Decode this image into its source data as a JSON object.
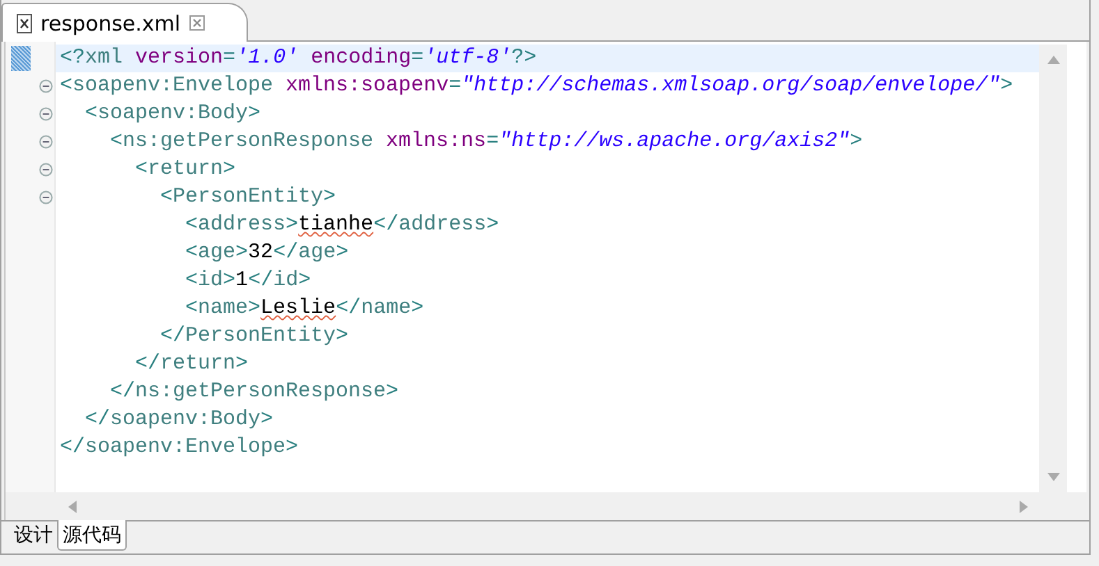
{
  "editor_tab": {
    "title": "response.xml",
    "selected": true
  },
  "lines": [
    {
      "current": true,
      "fold": false,
      "tokens": [
        {
          "kind": "bracket",
          "text": "<?"
        },
        {
          "kind": "tag",
          "text": "xml"
        },
        {
          "kind": "attr",
          "text": " version"
        },
        {
          "kind": "bracket",
          "text": "="
        },
        {
          "kind": "value",
          "text": "'1.0'"
        },
        {
          "kind": "attr",
          "text": " encoding"
        },
        {
          "kind": "bracket",
          "text": "="
        },
        {
          "kind": "value",
          "text": "'utf-8'"
        },
        {
          "kind": "bracket",
          "text": "?>"
        }
      ]
    },
    {
      "current": false,
      "fold": true,
      "tokens": [
        {
          "kind": "bracket",
          "text": "<"
        },
        {
          "kind": "tag",
          "text": "soapenv:Envelope"
        },
        {
          "kind": "attr",
          "text": " xmlns:soapenv"
        },
        {
          "kind": "bracket",
          "text": "="
        },
        {
          "kind": "value",
          "text": "\"http://schemas.xmlsoap.org/soap/envelope/\""
        },
        {
          "kind": "bracket",
          "text": ">"
        }
      ],
      "children": [
        {
          "current": false,
          "fold": true,
          "tokens": [
            {
              "kind": "bracket",
              "text": "<"
            },
            {
              "kind": "tag",
              "text": "soapenv:Body"
            },
            {
              "kind": "bracket",
              "text": ">"
            }
          ],
          "children": [
            {
              "current": false,
              "fold": true,
              "tokens": [
                {
                  "kind": "bracket",
                  "text": "<"
                },
                {
                  "kind": "tag",
                  "text": "ns:getPersonResponse"
                },
                {
                  "kind": "attr",
                  "text": " xmlns:ns"
                },
                {
                  "kind": "bracket",
                  "text": "="
                },
                {
                  "kind": "value",
                  "text": "\"http://ws.apache.org/axis2\""
                },
                {
                  "kind": "bracket",
                  "text": ">"
                }
              ],
              "children": [
                {
                  "current": false,
                  "fold": true,
                  "tokens": [
                    {
                      "kind": "bracket",
                      "text": "<"
                    },
                    {
                      "kind": "tag",
                      "text": "return"
                    },
                    {
                      "kind": "bracket",
                      "text": ">"
                    }
                  ],
                  "children": [
                    {
                      "current": false,
                      "fold": true,
                      "tokens": [
                        {
                          "kind": "bracket",
                          "text": "<"
                        },
                        {
                          "kind": "tag",
                          "text": "PersonEntity"
                        },
                        {
                          "kind": "bracket",
                          "text": ">"
                        }
                      ],
                      "children": [
                        {
                          "current": false,
                          "fold": false,
                          "tokens": [
                            {
                              "kind": "bracket",
                              "text": "<"
                            },
                            {
                              "kind": "tag",
                              "text": "address"
                            },
                            {
                              "kind": "bracket",
                              "text": ">"
                            },
                            {
                              "kind": "text",
                              "text": "tianhe",
                              "misspelled": true
                            },
                            {
                              "kind": "bracket",
                              "text": "</"
                            },
                            {
                              "kind": "tag",
                              "text": "address"
                            },
                            {
                              "kind": "bracket",
                              "text": ">"
                            }
                          ]
                        },
                        {
                          "current": false,
                          "fold": false,
                          "tokens": [
                            {
                              "kind": "bracket",
                              "text": "<"
                            },
                            {
                              "kind": "tag",
                              "text": "age"
                            },
                            {
                              "kind": "bracket",
                              "text": ">"
                            },
                            {
                              "kind": "text",
                              "text": "32",
                              "misspelled": false
                            },
                            {
                              "kind": "bracket",
                              "text": "</"
                            },
                            {
                              "kind": "tag",
                              "text": "age"
                            },
                            {
                              "kind": "bracket",
                              "text": ">"
                            }
                          ]
                        },
                        {
                          "current": false,
                          "fold": false,
                          "tokens": [
                            {
                              "kind": "bracket",
                              "text": "<"
                            },
                            {
                              "kind": "tag",
                              "text": "id"
                            },
                            {
                              "kind": "bracket",
                              "text": ">"
                            },
                            {
                              "kind": "text",
                              "text": "1",
                              "misspelled": false
                            },
                            {
                              "kind": "bracket",
                              "text": "</"
                            },
                            {
                              "kind": "tag",
                              "text": "id"
                            },
                            {
                              "kind": "bracket",
                              "text": ">"
                            }
                          ]
                        },
                        {
                          "current": false,
                          "fold": false,
                          "tokens": [
                            {
                              "kind": "bracket",
                              "text": "<"
                            },
                            {
                              "kind": "tag",
                              "text": "name"
                            },
                            {
                              "kind": "bracket",
                              "text": ">"
                            },
                            {
                              "kind": "text",
                              "text": "Leslie",
                              "misspelled": true
                            },
                            {
                              "kind": "bracket",
                              "text": "</"
                            },
                            {
                              "kind": "tag",
                              "text": "name"
                            },
                            {
                              "kind": "bracket",
                              "text": ">"
                            }
                          ]
                        }
                      ]
                    },
                    {
                      "current": false,
                      "fold": false,
                      "tokens": [
                        {
                          "kind": "bracket",
                          "text": "</"
                        },
                        {
                          "kind": "tag",
                          "text": "PersonEntity"
                        },
                        {
                          "kind": "bracket",
                          "text": ">"
                        }
                      ]
                    }
                  ]
                },
                {
                  "current": false,
                  "fold": false,
                  "tokens": [
                    {
                      "kind": "bracket",
                      "text": "</"
                    },
                    {
                      "kind": "tag",
                      "text": "return"
                    },
                    {
                      "kind": "bracket",
                      "text": ">"
                    }
                  ]
                }
              ]
            },
            {
              "current": false,
              "fold": false,
              "tokens": [
                {
                  "kind": "bracket",
                  "text": "</"
                },
                {
                  "kind": "tag",
                  "text": "ns:getPersonResponse"
                },
                {
                  "kind": "bracket",
                  "text": ">"
                }
              ]
            }
          ]
        },
        {
          "current": false,
          "fold": false,
          "tokens": [
            {
              "kind": "bracket",
              "text": "</"
            },
            {
              "kind": "tag",
              "text": "soapenv:Body"
            },
            {
              "kind": "bracket",
              "text": ">"
            }
          ]
        }
      ]
    },
    {
      "current": false,
      "fold": false,
      "tokens": [
        {
          "kind": "bracket",
          "text": "</"
        },
        {
          "kind": "tag",
          "text": "soapenv:Envelope"
        },
        {
          "kind": "bracket",
          "text": ">"
        }
      ]
    }
  ],
  "bottom_tabs": [
    {
      "label": "设计",
      "selected": false
    },
    {
      "label": "源代码",
      "selected": true
    }
  ]
}
